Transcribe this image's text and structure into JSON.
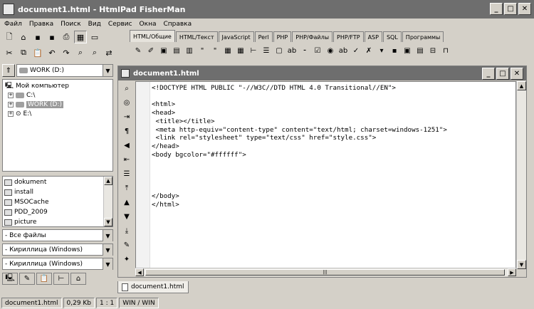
{
  "app": {
    "title": "document1.html - HtmlPad FisherMan"
  },
  "menu": [
    "Файл",
    "Правка",
    "Поиск",
    "Вид",
    "Сервис",
    "Окна",
    "Справка"
  ],
  "tabs": [
    "HTML/Общие",
    "HTML/Текст",
    "JavaScript",
    "Perl",
    "PHP",
    "PHP/Файлы",
    "PHP/FTP",
    "ASP",
    "SQL",
    "Программы"
  ],
  "active_tab": "HTML/Общие",
  "left_panel": {
    "drive": "WORK (D:)",
    "tree": [
      {
        "label": "Мой компьютер"
      },
      {
        "label": "C:\\"
      },
      {
        "label": "WORK (D:)",
        "selected": true
      },
      {
        "label": "E:\\"
      }
    ],
    "files": [
      "dokument",
      "install",
      "MSOCache",
      "PDD_2009",
      "picture"
    ],
    "filter": "- Все файлы",
    "encoding1": "- Кириллица (Windows)",
    "encoding2": "- Кириллица (Windows)"
  },
  "editor": {
    "title": "document1.html",
    "code": "<!DOCTYPE HTML PUBLIC \"-//W3C//DTD HTML 4.0 Transitional//EN\">\n\n<html>\n<head>\n <title></title>\n <meta http-equiv=\"content-type\" content=\"text/html; charset=windows-1251\">\n <link rel=\"stylesheet\" type=\"text/css\" href=\"style.css\">\n</head>\n<body bgcolor=\"#ffffff\">\n\n\n\n\n</body>\n</html>"
  },
  "doc_tab": "document1.html",
  "status": {
    "file": "document1.html",
    "size": "0,29 Kb",
    "position": "1 : 1",
    "encoding": "WIN / WIN"
  }
}
